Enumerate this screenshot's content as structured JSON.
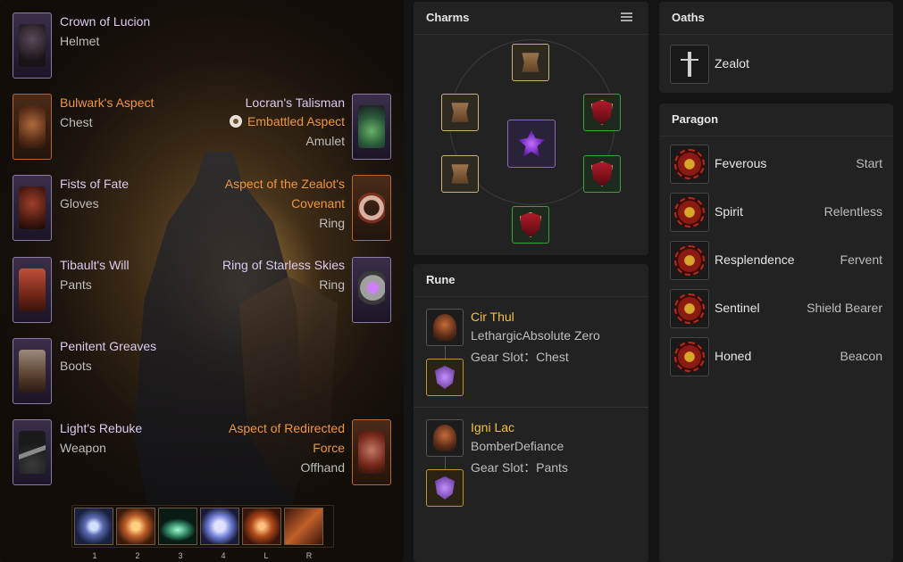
{
  "equipment": {
    "left_items": [
      {
        "name": "Crown of Lucion",
        "type": "Helmet",
        "rarity": "unique",
        "icon": "helmet-icon"
      },
      {
        "name": "Bulwark's Aspect",
        "type": "Chest",
        "rarity": "legendary",
        "icon": "chest-armor-icon"
      },
      {
        "name": "Fists of Fate",
        "type": "Gloves",
        "rarity": "unique",
        "icon": "gloves-icon"
      },
      {
        "name": "Tibault's Will",
        "type": "Pants",
        "rarity": "unique",
        "icon": "pants-icon"
      },
      {
        "name": "Penitent Greaves",
        "type": "Boots",
        "rarity": "unique",
        "icon": "boots-icon"
      },
      {
        "name": "Light's Rebuke",
        "type": "Weapon",
        "rarity": "unique",
        "icon": "flail-icon"
      }
    ],
    "right_items": [
      {
        "name": "Locran's Talisman",
        "aspect": "Embattled Aspect",
        "type": "Amulet",
        "rarity": "unique",
        "icon": "amulet-icon"
      },
      {
        "name_line1": "Aspect of the Zealot's",
        "name_line2": "Covenant",
        "type": "Ring",
        "rarity": "legendary",
        "icon": "ring-icon"
      },
      {
        "name": "Ring of Starless Skies",
        "type": "Ring",
        "rarity": "unique",
        "icon": "ring-icon"
      },
      {
        "name_line1": "Aspect of Redirected",
        "name_line2": "Force",
        "type": "Offhand",
        "rarity": "legendary",
        "icon": "shield-icon"
      }
    ],
    "skill_keys": [
      "1",
      "2",
      "3",
      "4",
      "L",
      "R"
    ]
  },
  "charms": {
    "title": "Charms"
  },
  "rune": {
    "title": "Rune",
    "entries": [
      {
        "name": "Cir Thul",
        "desc": "LethargicAbsolute Zero",
        "slot": "Gear Slot：Chest"
      },
      {
        "name": "Igni Lac",
        "desc": "BomberDefiance",
        "slot": "Gear Slot：Pants"
      }
    ]
  },
  "oaths": {
    "title": "Oaths",
    "name": "Zealot"
  },
  "paragon": {
    "title": "Paragon",
    "rows": [
      {
        "name": "Feverous",
        "value": "Start"
      },
      {
        "name": "Spirit",
        "value": "Relentless"
      },
      {
        "name": "Resplendence",
        "value": "Fervent"
      },
      {
        "name": "Sentinel",
        "value": "Shield Bearer"
      },
      {
        "name": "Honed",
        "value": "Beacon"
      }
    ]
  },
  "colors": {
    "unique": "#dccbf0",
    "legendary": "#f0953c",
    "rune_name": "#f2c04a",
    "panel_bg": "#222222"
  }
}
